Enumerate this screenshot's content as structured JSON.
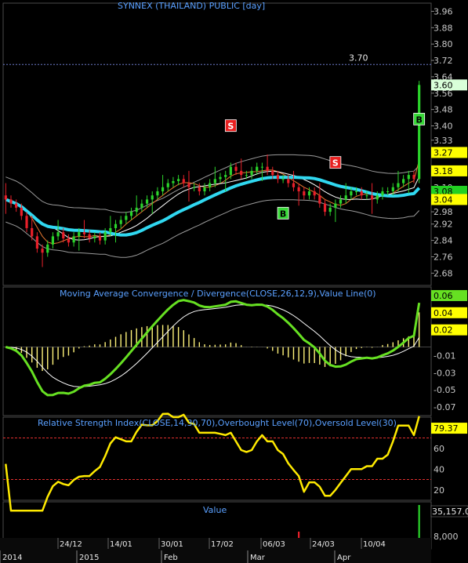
{
  "chart_data": [
    {
      "type": "candlestick",
      "title": "SYNNEX (THAILAND) PUBLIC [day]",
      "ylim": [
        2.62,
        4.0
      ],
      "yticks": [
        "3.96",
        "3.88",
        "3.80",
        "3.72",
        "3.64",
        "3.56",
        "3.48",
        "3.40",
        "3.33",
        "3.27",
        "3.18",
        "3.10",
        "3.04",
        "2.98",
        "2.92",
        "2.84",
        "2.76",
        "2.68"
      ],
      "grid": false,
      "dotted_level": {
        "label": "3.70",
        "value": 3.7
      },
      "closes": [
        3.04,
        3.02,
        3.0,
        2.96,
        2.9,
        2.86,
        2.8,
        2.78,
        2.82,
        2.86,
        2.88,
        2.85,
        2.83,
        2.86,
        2.88,
        2.87,
        2.85,
        2.86,
        2.84,
        2.88,
        2.9,
        2.92,
        2.94,
        2.96,
        2.98,
        3.0,
        3.02,
        3.04,
        3.06,
        3.08,
        3.1,
        3.12,
        3.13,
        3.14,
        3.12,
        3.1,
        3.1,
        3.08,
        3.1,
        3.12,
        3.14,
        3.15,
        3.16,
        3.2,
        3.18,
        3.16,
        3.16,
        3.18,
        3.2,
        3.2,
        3.18,
        3.16,
        3.14,
        3.14,
        3.12,
        3.1,
        3.08,
        3.06,
        3.08,
        3.06,
        3.02,
        2.98,
        3.0,
        3.02,
        3.04,
        3.06,
        3.08,
        3.08,
        3.06,
        3.06,
        3.04,
        3.06,
        3.08,
        3.08,
        3.1,
        3.12,
        3.14,
        3.16,
        3.14,
        3.6
      ],
      "value_labels": [
        "3.60",
        "3.27",
        "3.18",
        "3.08",
        "3.04"
      ],
      "signals": [
        {
          "label": "S",
          "type": "sell",
          "index": 43
        },
        {
          "label": "S",
          "type": "sell",
          "index": 63
        },
        {
          "label": "B",
          "type": "buy",
          "index": 53
        },
        {
          "label": "B",
          "type": "buy",
          "index": 84
        }
      ]
    },
    {
      "type": "line",
      "title": "Moving Average Convergence / Divergence(CLOSE,26,12,9),Value Line(0)",
      "yticks": [
        "0.06",
        "0.04",
        "0.02",
        "-0.01",
        "-0.03",
        "-0.05",
        "-0.07"
      ],
      "ylim": [
        -0.08,
        0.07
      ],
      "value_labels": [
        "0.06",
        "0.04",
        "0.02"
      ]
    },
    {
      "type": "line",
      "title": "Relative Strength Index(CLOSE,14,30,70),Overbought Level(70),Oversold Level(30)",
      "ylim": [
        10,
        90
      ],
      "yticks": [
        "80",
        "60",
        "40",
        "20"
      ],
      "value_label": "79.37",
      "levels": [
        70,
        30
      ]
    },
    {
      "type": "bar",
      "title": "Value",
      "value_label": "35,157.00",
      "yticks": [
        "8,000"
      ]
    }
  ],
  "x_axis": {
    "date_labels": [
      "24/12",
      "14/01",
      "30/01",
      "17/02",
      "06/03",
      "24/03",
      "10/04"
    ],
    "month_labels": [
      "2014",
      "2015",
      "Feb",
      "Mar",
      "Apr"
    ]
  },
  "colors": {
    "up": "#2bd42b",
    "down": "#e8202a",
    "ma_main": "#30d8f0",
    "macd_line": "#66e022",
    "hist": "#fff37a",
    "rsi_line": "#ffea00",
    "title": "#5aa0ff",
    "level_line": "#e03030"
  }
}
